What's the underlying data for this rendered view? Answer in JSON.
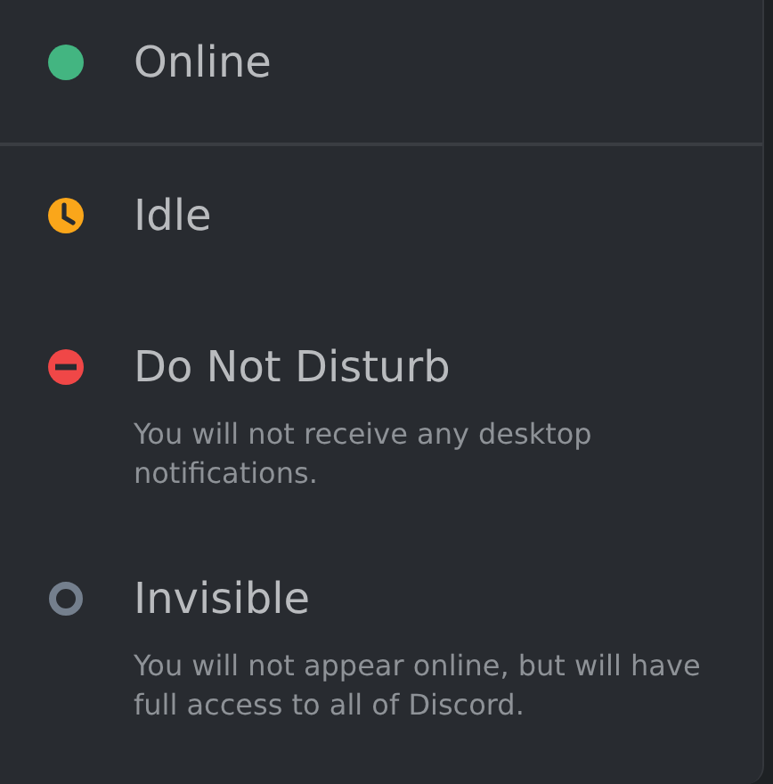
{
  "status_menu": {
    "items": [
      {
        "kind": "online",
        "label": "Online",
        "color": "#43b581"
      },
      {
        "kind": "idle",
        "label": "Idle",
        "color": "#faa61a"
      },
      {
        "kind": "dnd",
        "label": "Do Not Disturb",
        "color": "#f04747",
        "description": "You will not receive any desktop notifications."
      },
      {
        "kind": "invisible",
        "label": "Invisible",
        "color": "#747f8d",
        "description": "You will not appear online, but will have full access to all of Discord."
      }
    ]
  }
}
